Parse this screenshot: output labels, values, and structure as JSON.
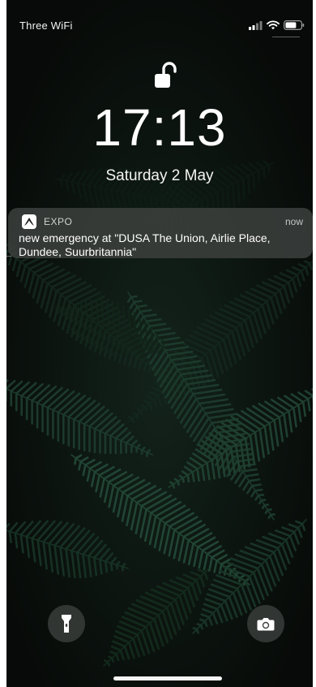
{
  "status_bar": {
    "carrier": "Three WiFi",
    "signal_icon": "cellular-signal-icon",
    "wifi_icon": "wifi-icon",
    "battery_icon": "battery-icon"
  },
  "lock_screen": {
    "lock_icon": "unlocked-padlock-icon",
    "time": "17:13",
    "date": "Saturday 2 May"
  },
  "notification": {
    "app_icon": "expo-app-icon",
    "app_name": "EXPO",
    "time": "now",
    "message": "new emergency at \"DUSA The Union, Airlie Place, Dundee, Suurbritannia\""
  },
  "quick_actions": {
    "flashlight_icon": "flashlight-icon",
    "camera_icon": "camera-icon"
  },
  "colors": {
    "background": "#0c100e",
    "fern": "#1c3a2c",
    "notification_bg": "#3e423f"
  }
}
